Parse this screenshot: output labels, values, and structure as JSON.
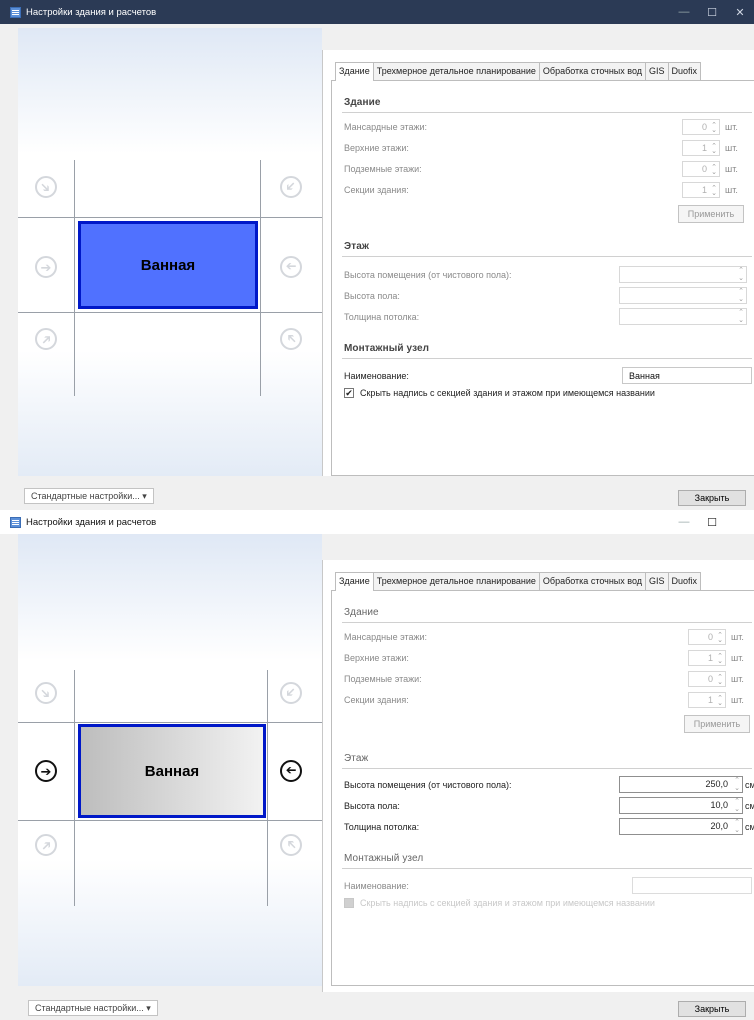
{
  "window_title": "Настройки здания и расчетов",
  "tabs": [
    "Здание",
    "Трехмерное детальное планирование",
    "Обработка сточных вод",
    "GIS",
    "Duofix"
  ],
  "cell_label": "Ванная",
  "sections": {
    "building": "Здание",
    "floor": "Этаж",
    "mount": "Монтажный узел"
  },
  "building_rows": [
    {
      "label": "Мансардные этажи:",
      "value": "0",
      "unit": "шт."
    },
    {
      "label": "Верхние этажи:",
      "value": "1",
      "unit": "шт."
    },
    {
      "label": "Подземные этажи:",
      "value": "0",
      "unit": "шт."
    },
    {
      "label": "Секции здания:",
      "value": "1",
      "unit": "шт."
    }
  ],
  "apply_label": "Применить",
  "floor_labels": [
    "Высота помещения (от чистового пола):",
    "Высота пола:",
    "Толщина потолка:"
  ],
  "floor_values_2": [
    {
      "value": "250,0",
      "unit": "см"
    },
    {
      "value": "10,0",
      "unit": "см"
    },
    {
      "value": "20,0",
      "unit": "см"
    }
  ],
  "name_label": "Наименование:",
  "name_value": "Ванная",
  "hide_label": "Скрыть надпись с секцией здания и этажом при имеющемся названии",
  "check_mark": "✔",
  "std_label": "Стандартные настройки...",
  "dd_arrow": "▾",
  "close_label": "Закрыть",
  "controls": {
    "min": "—",
    "max": "☐",
    "close": "✕"
  },
  "arrows": {
    "down_right": "➘",
    "right": "➔",
    "up_right": "➚",
    "down_left": "➘",
    "left": "➔",
    "up_left": "➚"
  },
  "colors": {
    "active_cell_1": "#5071ff",
    "cell_border": "#0018c8",
    "titlebar_1": "#2b3a55"
  }
}
